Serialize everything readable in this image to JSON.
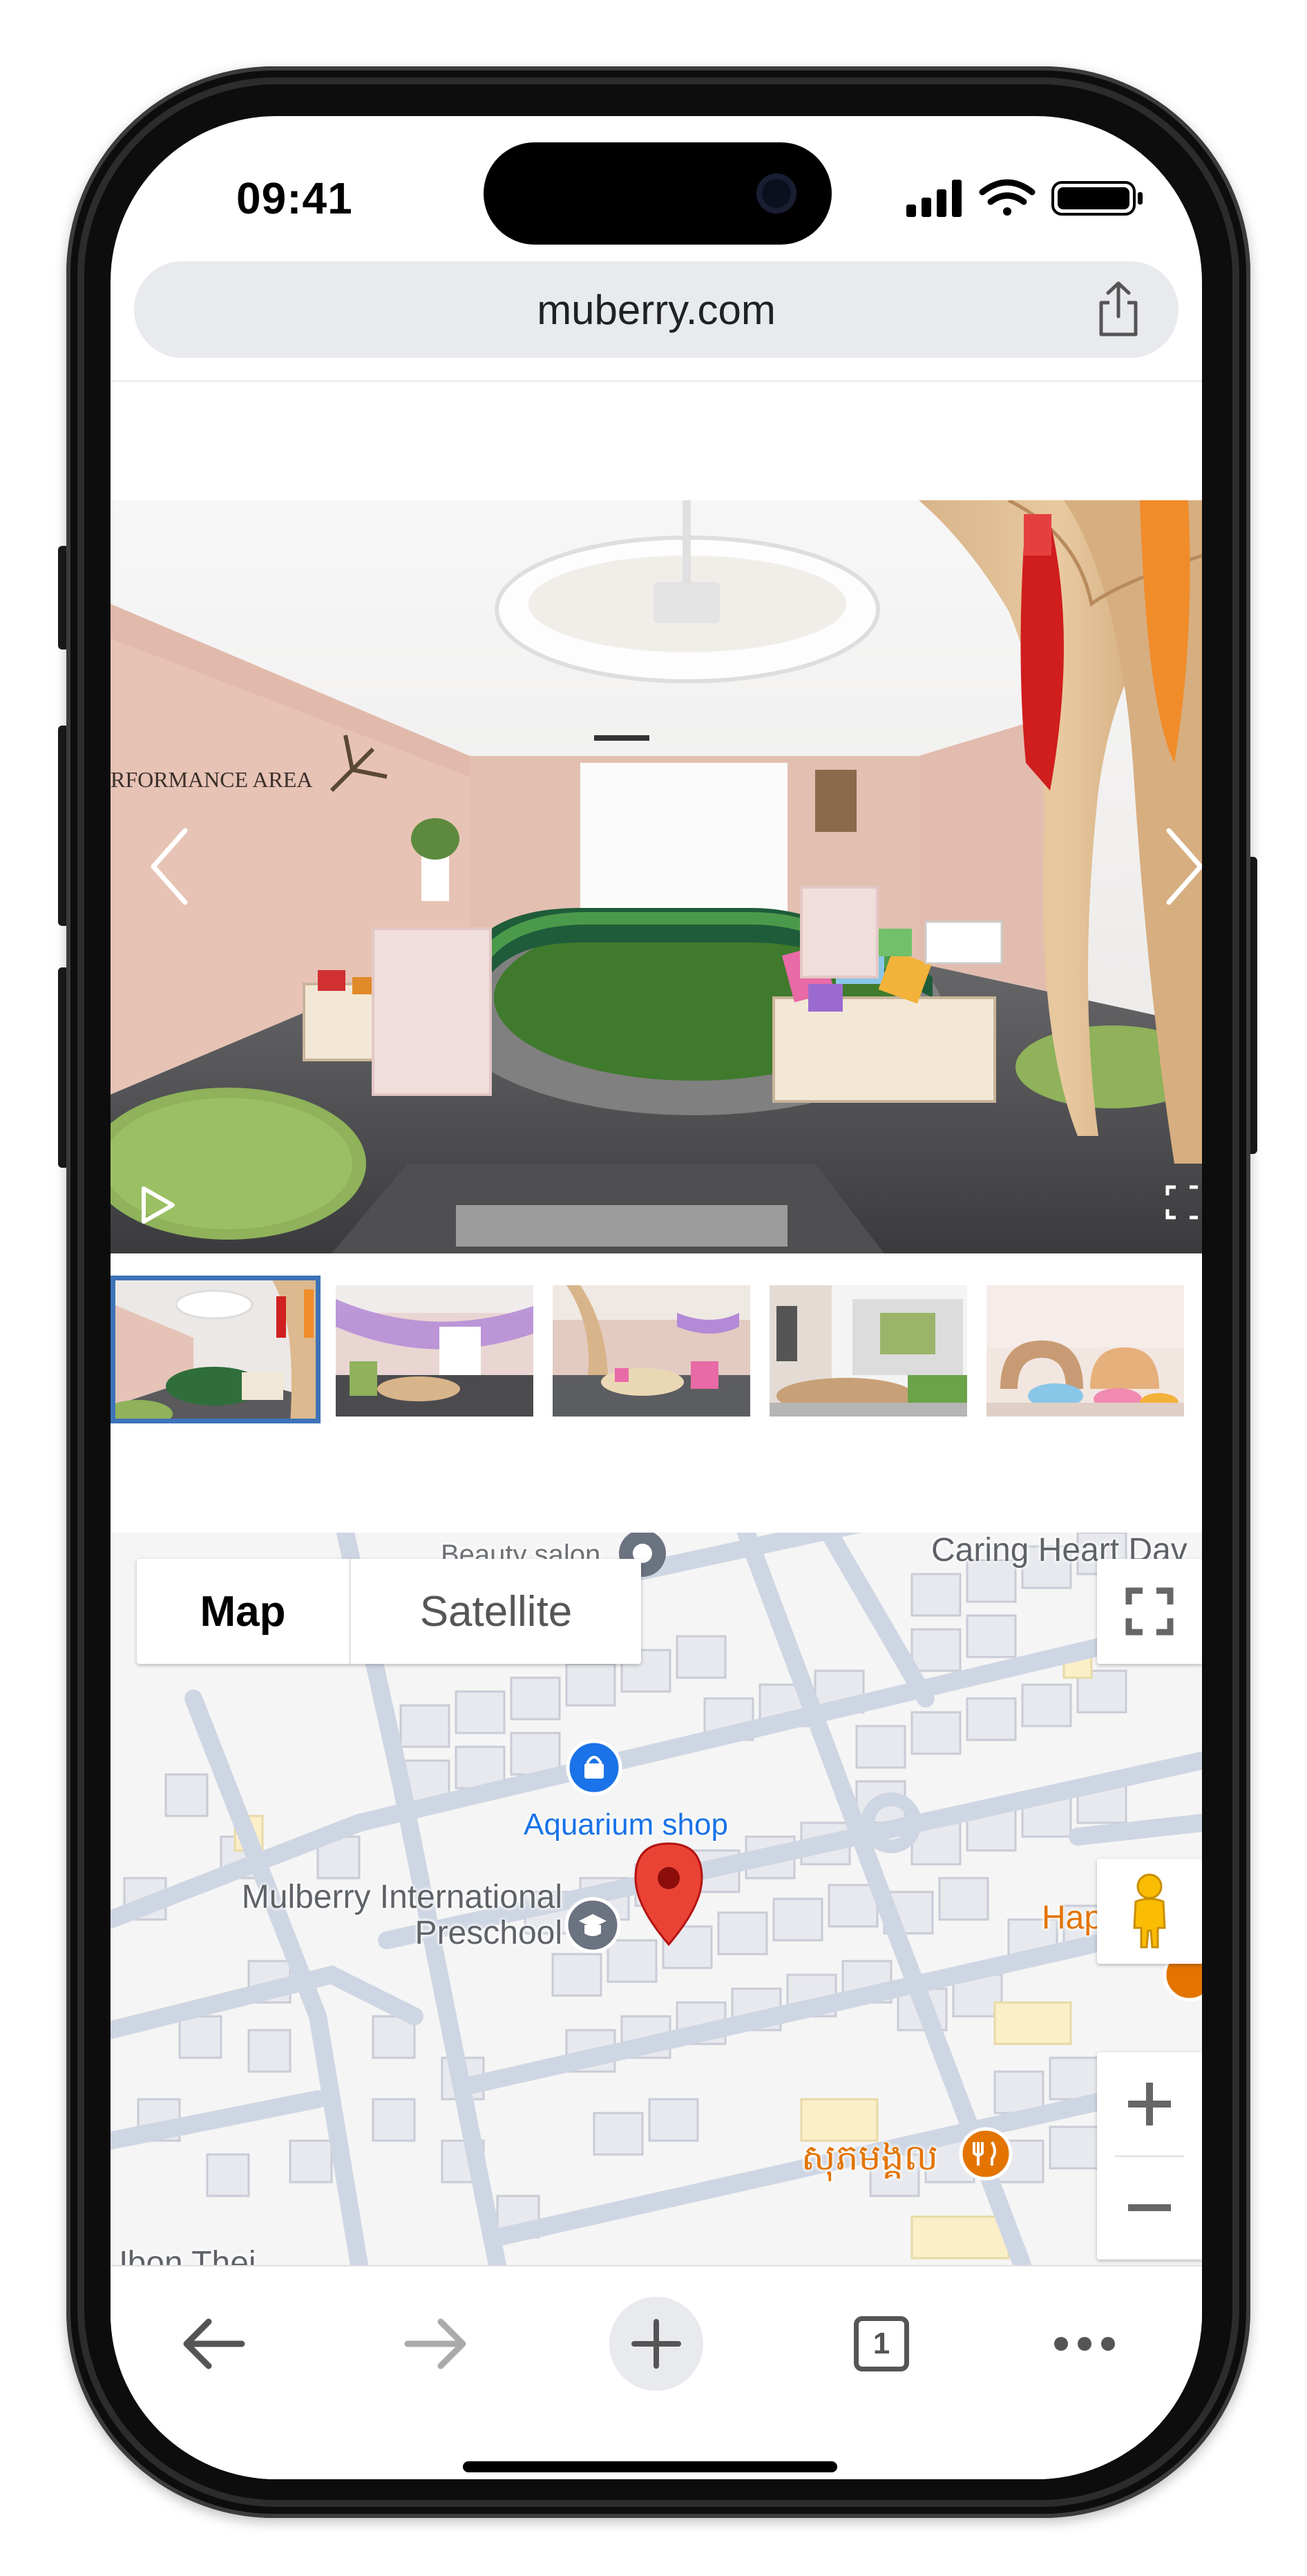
{
  "status_bar": {
    "time": "09:41",
    "icons": [
      "signal-icon",
      "wifi-icon",
      "battery-icon"
    ]
  },
  "browser": {
    "url": "muberry.com",
    "share_icon": "share-icon"
  },
  "gallery": {
    "main_photo_sign": "RFORMANCE AREA",
    "prev_icon": "chevron-left-icon",
    "next_icon": "chevron-right-icon",
    "play_icon": "play-icon",
    "fullscreen_icon": "fullscreen-icon",
    "thumbnail_count": 5,
    "selected_thumbnail": 1
  },
  "map": {
    "type_control": {
      "map_label": "Map",
      "satellite_label": "Satellite",
      "selected": "Map"
    },
    "labels": {
      "beauty_salon": "Beauty salon",
      "caring_heart": "Caring Heart Dav",
      "aquarium": "Aquarium shop",
      "preschool_line1": "Mulberry International",
      "preschool_line2": "Preschool",
      "hap": "Hap",
      "khmer_restaurant": "សុភមង្គល",
      "bottom_left": "Ubon Thei"
    },
    "colors": {
      "aquarium_label": "#1a73e8",
      "restaurant_label": "#e37400",
      "marker": "#ea4335"
    },
    "controls": {
      "fullscreen_icon": "fullscreen-icon",
      "pegman_icon": "pegman-icon",
      "zoom_in_icon": "plus-icon",
      "zoom_out_icon": "minus-icon"
    }
  },
  "toolbar": {
    "back_icon": "arrow-left-icon",
    "forward_icon": "arrow-right-icon",
    "new_tab_icon": "plus-icon",
    "tab_count": "1",
    "more_icon": "more-horizontal-icon"
  }
}
